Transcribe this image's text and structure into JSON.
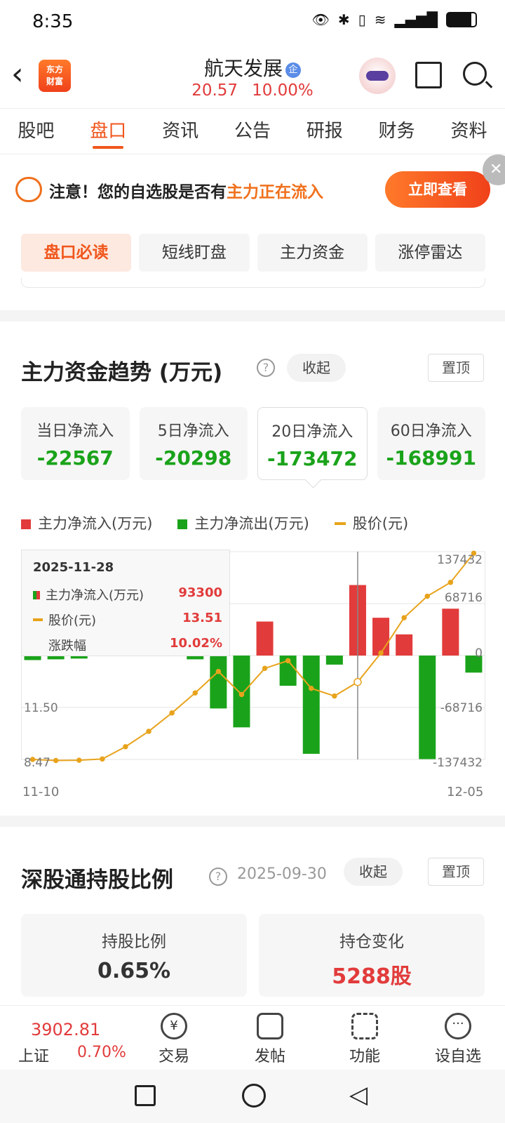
{
  "status": {
    "time": "8:35",
    "icons": [
      "eye-icon",
      "bluetooth-icon",
      "vibrate-icon",
      "wifi-icon",
      "4g-signal-icon",
      "battery-icon"
    ]
  },
  "header": {
    "title": "航天发展",
    "company_badge": "企",
    "price": "20.57",
    "change_pct": "10.00%",
    "logo_text_1": "东方",
    "logo_text_2": "财富"
  },
  "tabs": [
    "股吧",
    "盘口",
    "资讯",
    "公告",
    "研报",
    "财务",
    "资料"
  ],
  "tabs_active": 1,
  "notice": {
    "prefix": "注意！您的自选股是否有",
    "highlight": "主力正在流入",
    "button": "立即查看"
  },
  "subtabs": [
    "盘口必读",
    "短线盯盘",
    "主力资金",
    "涨停雷达"
  ],
  "flow": {
    "title": "主力资金趋势 (万元)",
    "collapse": "收起",
    "pin": "置顶",
    "cards": [
      {
        "label": "当日净流入",
        "value": "-22567"
      },
      {
        "label": "5日净流入",
        "value": "-20298"
      },
      {
        "label": "20日净流入",
        "value": "-173472"
      },
      {
        "label": "60日净流入",
        "value": "-168991"
      }
    ],
    "legend": {
      "inflow": "主力净流入(万元)",
      "outflow": "主力净流出(万元)",
      "price": "股价(元)"
    },
    "tooltip": {
      "date": "2025-11-28",
      "inflow_label": "主力净流入(万元)",
      "inflow_value": "93300",
      "price_label": "股价(元)",
      "price_value": "13.51",
      "pct_label": "涨跌幅",
      "pct_value": "10.02%"
    }
  },
  "chart_data": {
    "type": "bar",
    "x": [
      "11-10",
      "11-11",
      "11-12",
      "11-13",
      "11-14",
      "11-17",
      "11-18",
      "11-19",
      "11-20",
      "11-21",
      "11-24",
      "11-25",
      "11-26",
      "11-27",
      "11-28",
      "12-01",
      "12-02",
      "12-03",
      "12-04",
      "12-05"
    ],
    "x_tick_labels": [
      "11-10",
      "12-05"
    ],
    "series": [
      {
        "name": "主力净流入(万元)/主力净流出(万元)",
        "values": [
          -6000,
          -5000,
          -4000,
          0,
          0,
          0,
          0,
          -5000,
          -70000,
          -95000,
          45000,
          -40000,
          -130000,
          -12000,
          93300,
          50000,
          28000,
          -137000,
          62000,
          -22567
        ]
      },
      {
        "name": "股价(元)",
        "values": [
          8.47,
          8.4,
          8.42,
          8.5,
          9.3,
          10.3,
          11.5,
          12.8,
          14.2,
          12.7,
          14.4,
          14.9,
          13.1,
          12.6,
          13.51,
          15.4,
          17.7,
          19.1,
          20.0,
          21.9
        ]
      }
    ],
    "left_ticks": [
      "11.50",
      "8.47"
    ],
    "right_ticks": [
      "137432",
      "68716",
      "0",
      "-68716",
      "-137432"
    ],
    "flow_range": [
      -137432,
      137432
    ],
    "price_range": [
      8.47,
      22.0
    ],
    "grid": true,
    "selected_date": "11-28"
  },
  "sgt": {
    "title": "深股通持股比例",
    "date": "2025-09-30",
    "collapse": "收起",
    "pin": "置顶",
    "hold_label": "持股比例",
    "hold_value": "0.65%",
    "change_label": "持仓变化",
    "change_value": "5288股"
  },
  "bottom": {
    "index_value": "3902.81",
    "index_name": "上证",
    "index_pct": "0.70%",
    "items": [
      "交易",
      "发帖",
      "功能",
      "设自选"
    ]
  },
  "colors": {
    "accent": "#f0561c",
    "rise": "#e23b3b",
    "fall": "#1aa31a",
    "price_line": "#e8a31c"
  }
}
